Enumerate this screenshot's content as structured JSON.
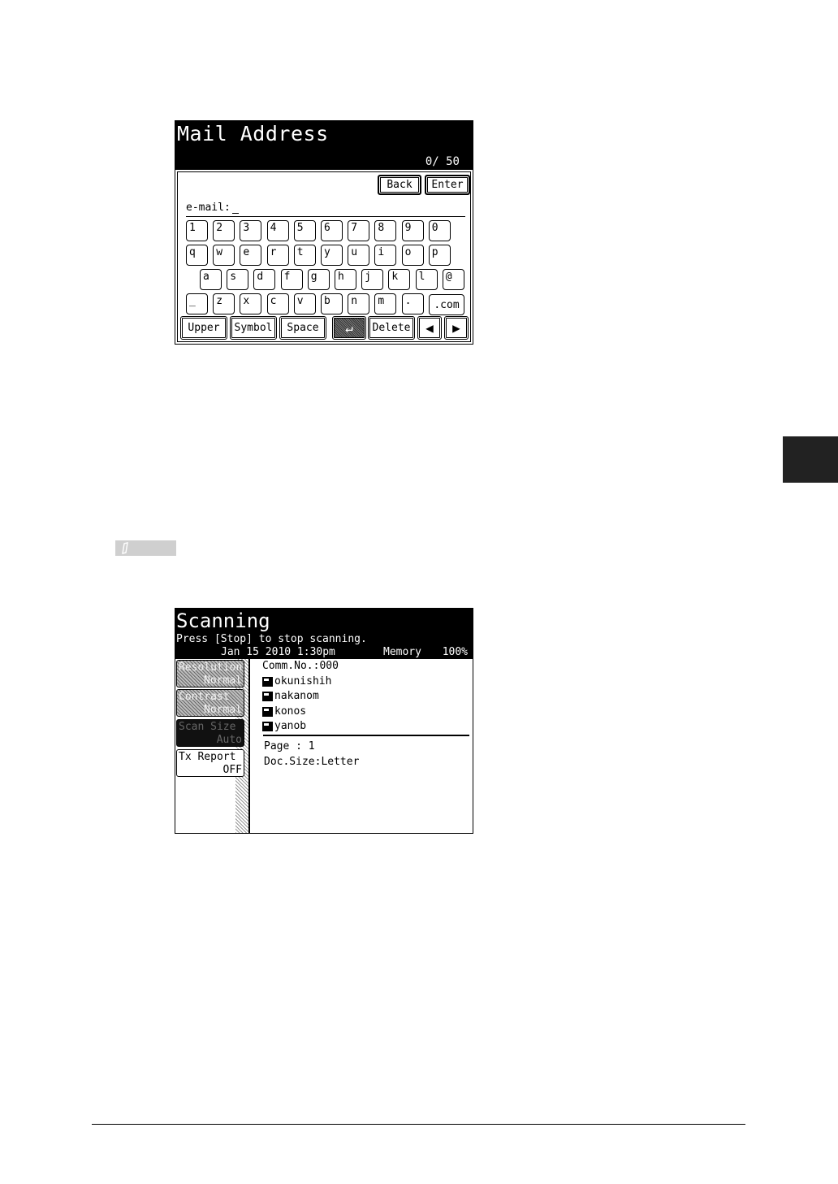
{
  "mail_screen": {
    "title": "Mail Address",
    "counter": "0/ 50",
    "back_label": "Back",
    "enter_label": "Enter",
    "field_label": "e-mail:",
    "field_value": "",
    "rows": [
      [
        "1",
        "2",
        "3",
        "4",
        "5",
        "6",
        "7",
        "8",
        "9",
        "0"
      ],
      [
        "q",
        "w",
        "e",
        "r",
        "t",
        "y",
        "u",
        "i",
        "o",
        "p"
      ],
      [
        "a",
        "s",
        "d",
        "f",
        "g",
        "h",
        "j",
        "k",
        "l",
        "@"
      ],
      [
        "_",
        "z",
        "x",
        "c",
        "v",
        "b",
        "n",
        "m",
        "."
      ]
    ],
    "com_label": ".com",
    "bottom": {
      "upper": "Upper",
      "symbol": "Symbol",
      "space": "Space",
      "enter_glyph": "↵",
      "delete": "Delete",
      "left": "◀",
      "right": "▶"
    }
  },
  "scan_screen": {
    "title": "Scanning",
    "subtitle": "Press [Stop] to stop scanning.",
    "date": "Jan 15 2010  1:30pm",
    "memory": "Memory",
    "zoom": "100%",
    "side_buttons": [
      {
        "label": "Resolution",
        "value": "Normal",
        "style": "hatched"
      },
      {
        "label": "Contrast",
        "value": "Normal",
        "style": "hatched"
      },
      {
        "label": "Scan Size",
        "value": "Auto",
        "style": "black"
      },
      {
        "label": "Tx Report",
        "value": "OFF",
        "style": "plain"
      }
    ],
    "comm_no": "Comm.No.:000",
    "destinations": [
      "okunishih",
      "nakanom",
      "konos",
      "yanob"
    ],
    "page": "Page :  1",
    "doc_size": "Doc.Size:Letter"
  }
}
